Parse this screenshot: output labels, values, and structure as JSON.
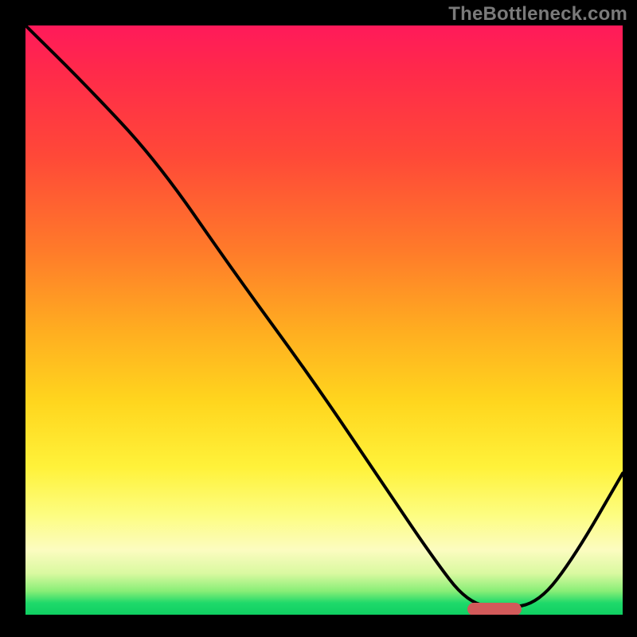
{
  "watermark": "TheBottleneck.com",
  "chart_data": {
    "type": "line",
    "title": "",
    "xlabel": "",
    "ylabel": "",
    "xlim": [
      0,
      100
    ],
    "ylim": [
      0,
      100
    ],
    "grid": false,
    "legend": false,
    "background_gradient": {
      "direction": "vertical",
      "stops": [
        {
          "pos": 0,
          "color": "#ff1a5a"
        },
        {
          "pos": 22,
          "color": "#ff4838"
        },
        {
          "pos": 52,
          "color": "#ffae20"
        },
        {
          "pos": 75,
          "color": "#fff23a"
        },
        {
          "pos": 89,
          "color": "#fcfcc0"
        },
        {
          "pos": 100,
          "color": "#0fcf62"
        }
      ]
    },
    "series": [
      {
        "name": "bottleneck-curve",
        "color": "#000000",
        "x": [
          0,
          10,
          22,
          35,
          48,
          60,
          68,
          74,
          80,
          86,
          92,
          100
        ],
        "values": [
          100,
          90,
          77,
          58,
          40,
          22,
          10,
          2,
          1,
          2,
          10,
          24
        ]
      }
    ],
    "marker": {
      "shape": "pill",
      "color": "#d25a5a",
      "x_from": 74,
      "x_to": 83,
      "y": 1
    }
  }
}
